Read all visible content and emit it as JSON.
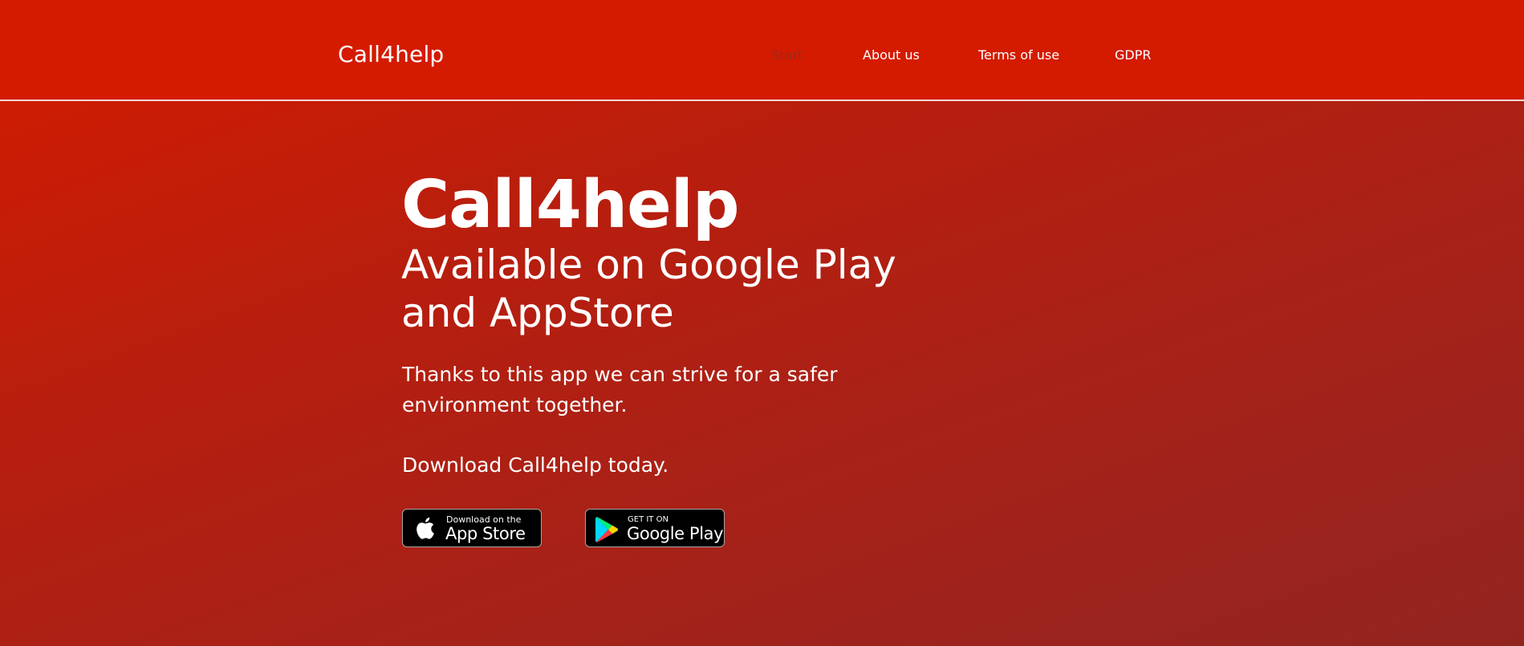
{
  "header": {
    "brand": "Call4help",
    "nav": [
      {
        "label": "Start",
        "active": true
      },
      {
        "label": "About us",
        "active": false
      },
      {
        "label": "Terms of use",
        "active": false
      },
      {
        "label": "GDPR",
        "active": false
      }
    ]
  },
  "hero": {
    "title": "Call4help",
    "subtitle": "Available on Google Play and AppStore",
    "description": "Thanks to this app we can strive for a safer environment together.",
    "cta": "Download Call4help today."
  },
  "badges": {
    "appstore": {
      "small": "Download on the",
      "big": "App Store",
      "icon": "apple-icon"
    },
    "googleplay": {
      "small": "GET IT ON",
      "big": "Google Play",
      "icon": "google-play-icon"
    }
  },
  "colors": {
    "header_bg": "#d41b00",
    "gradient_start": "#d41b00",
    "gradient_end": "#922420",
    "active_nav": "#9a2a1c",
    "text": "#ffffff",
    "badge_bg": "#000000"
  }
}
